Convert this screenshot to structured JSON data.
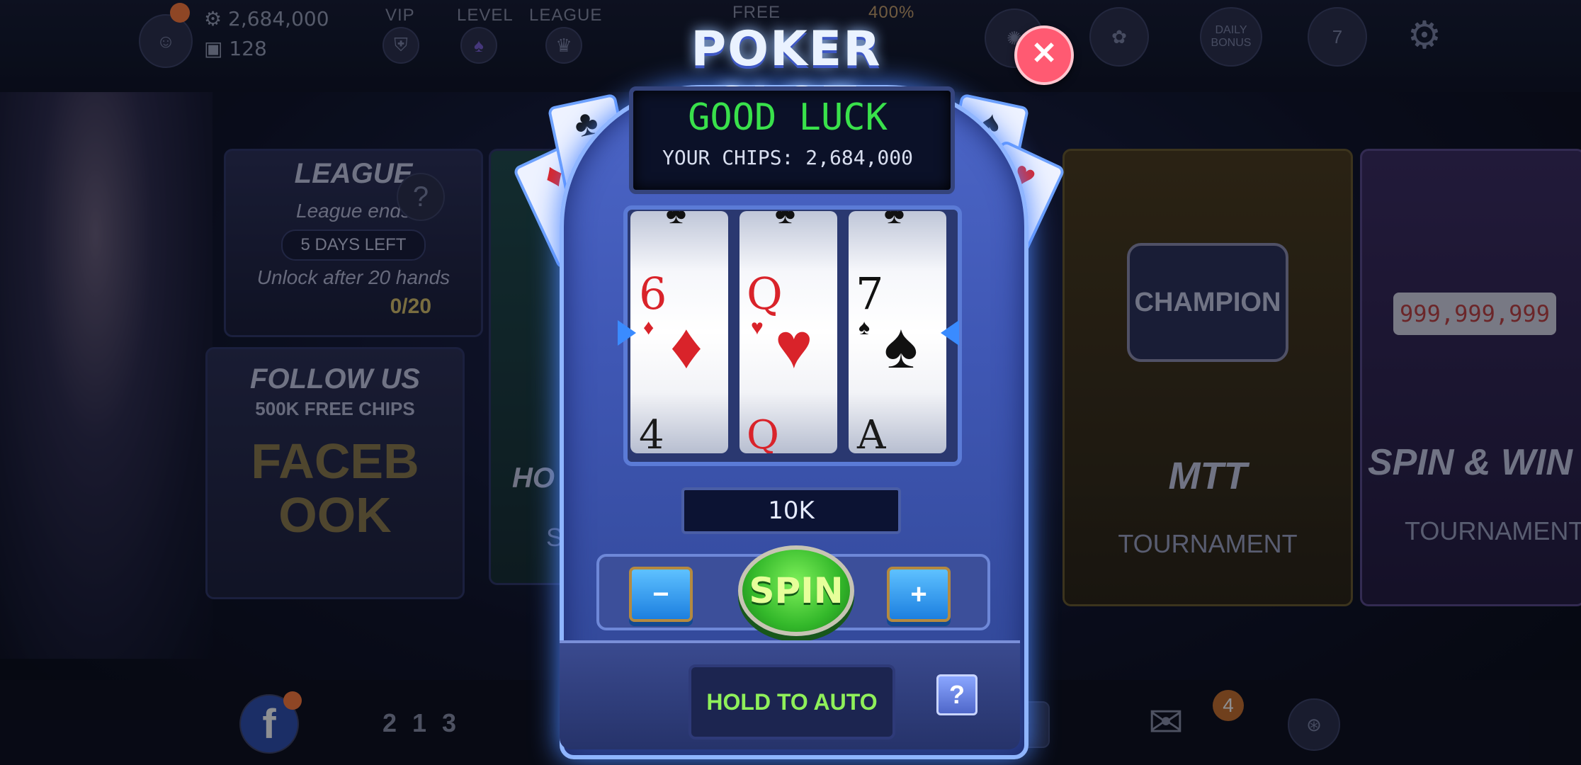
{
  "topbar": {
    "chips": "2,684,000",
    "tickets": "128",
    "vip_label": "VIP",
    "level_label": "LEVEL",
    "league_label": "LEAGUE",
    "free_label": "FREE",
    "bonus_pct": "400%",
    "daily_bonus_label": "DAILY BONUS"
  },
  "cards": {
    "league_title": "LEAGUE",
    "league_ends": "League ends",
    "days_left": "5 DAYS LEFT",
    "unlock": "Unlock after 20 hands",
    "progress": "0/20",
    "follow_title": "FOLLOW US",
    "follow_sub": "500K FREE CHIPS",
    "facebook": "FACEBOOK",
    "mtt_title": "MTT",
    "mtt_sub": "TOURNAMENT",
    "champion": "CHAMPION",
    "spin_title": "SPIN & WIN",
    "spin_sub": "TOURNAMENT",
    "spin_amount": "999,999,999",
    "partial_left_title": "HO",
    "partial_left_sub": "SI"
  },
  "bottombar": {
    "mail_badge": "4",
    "leaderboard": "2 1 3"
  },
  "slot": {
    "title": "POKER SLOT",
    "status": "GOOD LUCK",
    "chips_line": "YOUR CHIPS: 2,684,000",
    "bet": "10K",
    "spin": "SPIN",
    "minus": "−",
    "plus": "+",
    "hold_to_auto": "HOLD TO AUTO",
    "help": "?",
    "close": "✕",
    "reels": [
      {
        "rank": "6",
        "suit": "♦",
        "color": "#d9232a",
        "next_rank": "4",
        "next_color": "#1a1a1a",
        "prev_suit": "♣"
      },
      {
        "rank": "Q",
        "suit": "♥",
        "color": "#d9232a",
        "next_rank": "Q",
        "next_color": "#d9232a",
        "prev_suit": "♣"
      },
      {
        "rank": "7",
        "suit": "♠",
        "color": "#111111",
        "next_rank": "A",
        "next_color": "#1a1a1a",
        "prev_suit": "♣"
      }
    ]
  }
}
